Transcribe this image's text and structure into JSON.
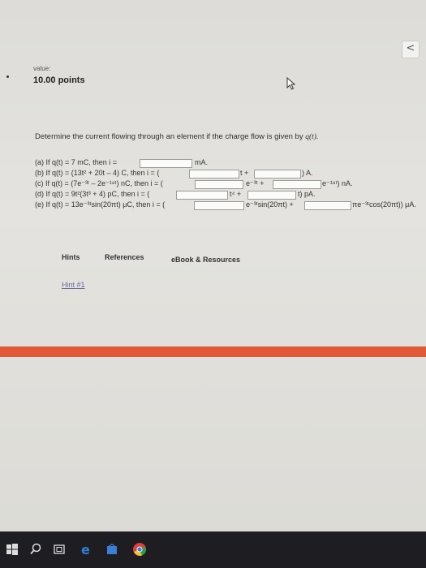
{
  "header": {
    "value_label": "value:",
    "points": "10.00 points"
  },
  "nav": {
    "next_icon": "chevron-left-icon",
    "label": "<"
  },
  "question": {
    "intro_text": "Determine the current flowing through an element if the charge flow is given by ",
    "intro_var": "q(t).",
    "parts": [
      {
        "id": "a",
        "text": "(a) If q(t) = 7 mC, then i =",
        "units": [
          "mA."
        ]
      },
      {
        "id": "b",
        "text": "(b) If q(t) = (13t² + 20t – 4) C, then i = (",
        "units": [
          "t +",
          ") A."
        ]
      },
      {
        "id": "c",
        "text": "(c) If q(t) = (7e⁻³ᵗ – 2e⁻¹⁸ᵗ) nC, then i = (",
        "units": [
          "e⁻³ᵗ +",
          "e⁻¹⁸ᵗ) nA."
        ]
      },
      {
        "id": "d",
        "text": "(d) If q(t) = 9t²(3t³ + 4) pC, then i = (",
        "units": [
          "t⁴ +",
          "t) pA."
        ]
      },
      {
        "id": "e",
        "text": "(e) If q(t) = 13e⁻³ᵗsin(20πt) μC, then i = (",
        "units": [
          "e⁻³ᵗsin(20πt) +",
          "πe⁻³ᵗcos(20πt)) μA."
        ]
      }
    ]
  },
  "links": {
    "hints": "Hints",
    "references": "References",
    "ebook": "eBook & Resources",
    "hint1": "Hint #1"
  },
  "colors": {
    "accent_bar": "#e05a3a",
    "taskbar": "#1e1e22"
  },
  "taskbar": {
    "icons": [
      "windows-start-icon",
      "search-icon",
      "task-view-icon",
      "edge-browser-icon",
      "store-icon",
      "chrome-icon"
    ]
  }
}
